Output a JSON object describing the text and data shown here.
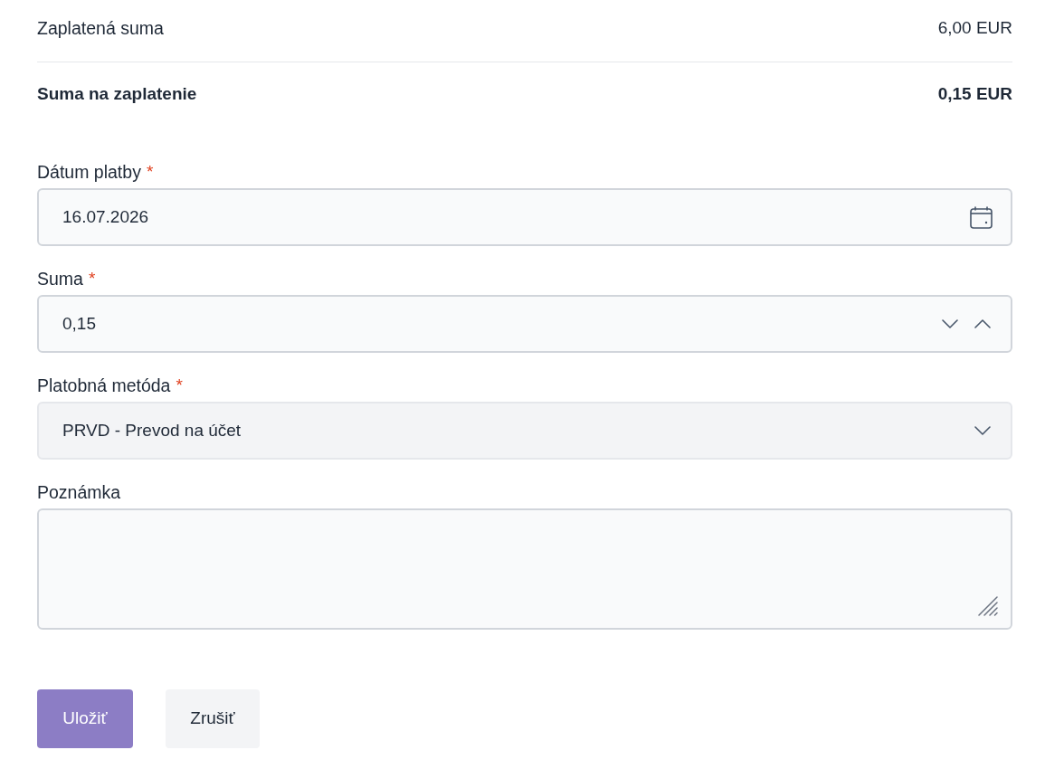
{
  "summary": [
    {
      "label": "Zaplatená suma",
      "value": "6,00 EUR",
      "emphasis": false
    },
    {
      "label": "Suma na zaplatenie",
      "value": "0,15 EUR",
      "emphasis": true
    }
  ],
  "fields": [
    {
      "kind": "date",
      "label": "Dátum platby",
      "marker": "*",
      "value": "16.07.2026"
    },
    {
      "kind": "number",
      "label": "Suma",
      "marker": "*",
      "value": "0,15"
    },
    {
      "kind": "select",
      "label": "Platobná metóda",
      "marker": "*",
      "value": "PRVD - Prevod na účet"
    },
    {
      "kind": "textarea",
      "label": "Poznámka"
    }
  ],
  "buttons": [
    {
      "label": "Uložiť",
      "kind": "primary"
    },
    {
      "label": "Zrušiť",
      "kind": "secondary"
    }
  ]
}
